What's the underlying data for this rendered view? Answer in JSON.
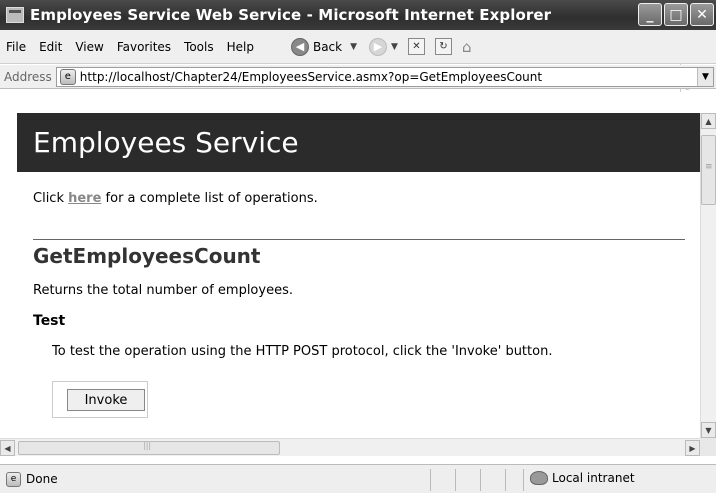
{
  "window": {
    "title": "Employees Service Web Service - Microsoft Internet Explorer",
    "minimize": "_",
    "maximize": "□",
    "close": "✕"
  },
  "menu": {
    "items": [
      {
        "label": "File"
      },
      {
        "label": "Edit"
      },
      {
        "label": "View"
      },
      {
        "label": "Favorites"
      },
      {
        "label": "Tools"
      },
      {
        "label": "Help"
      }
    ]
  },
  "toolbar": {
    "back_label": "Back",
    "more": "»"
  },
  "address": {
    "label": "Address",
    "url": "http://localhost/Chapter24/EmployeesService.asmx?op=GetEmployeesCount"
  },
  "page": {
    "banner_title": "Employees Service",
    "intro_before": "Click ",
    "intro_link": "here",
    "intro_after": " for a complete list of operations.",
    "operation_title": "GetEmployeesCount",
    "operation_desc": "Returns the total number of employees.",
    "test_heading": "Test",
    "test_desc": "To test the operation using the HTTP POST protocol, click the 'Invoke' button.",
    "invoke_label": "Invoke"
  },
  "status": {
    "text": "Done",
    "zone": "Local intranet"
  }
}
